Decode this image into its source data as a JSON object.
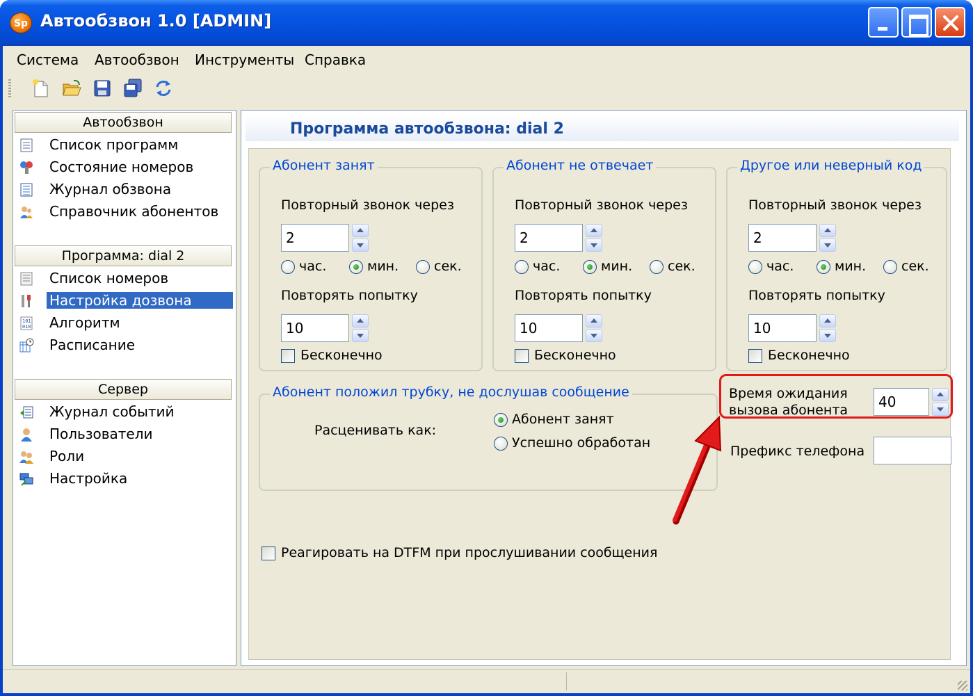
{
  "window": {
    "title": "Автообзвон 1.0 [ADMIN]",
    "icon_label": "Sp"
  },
  "menu": [
    "Система",
    "Автообзвон",
    "Инструменты",
    "Справка"
  ],
  "toolbar": [
    "new-icon",
    "open-icon",
    "save-icon",
    "save-all-icon",
    "refresh-icon"
  ],
  "sidebar": {
    "sections": [
      {
        "header": "Автообзвон",
        "items": [
          {
            "label": "Список программ",
            "icon": "list-icon"
          },
          {
            "label": "Состояние номеров",
            "icon": "status-icon"
          },
          {
            "label": "Журнал обзвона",
            "icon": "log-icon"
          },
          {
            "label": "Справочник абонентов",
            "icon": "contacts-icon"
          }
        ]
      },
      {
        "header": "Программа: dial 2",
        "items": [
          {
            "label": "Список номеров",
            "icon": "numbers-icon"
          },
          {
            "label": "Настройка дозвона",
            "icon": "tools-icon",
            "selected": true
          },
          {
            "label": "Алгоритм",
            "icon": "algorithm-icon"
          },
          {
            "label": "Расписание",
            "icon": "schedule-icon"
          }
        ]
      },
      {
        "header": "Сервер",
        "items": [
          {
            "label": "Журнал событий",
            "icon": "events-icon"
          },
          {
            "label": "Пользователи",
            "icon": "user-icon"
          },
          {
            "label": "Роли",
            "icon": "roles-icon"
          },
          {
            "label": "Настройка",
            "icon": "settings-icon"
          }
        ]
      }
    ]
  },
  "main": {
    "title": "Программа автообзвона: dial 2",
    "groups": [
      {
        "title": "Абонент занят",
        "retry_label": "Повторный звонок через",
        "retry_value": "2",
        "units": [
          "час.",
          "мин.",
          "сек."
        ],
        "unit_selected": "мин.",
        "repeat_label": "Повторять попытку",
        "repeat_value": "10",
        "infinite_label": "Бесконечно",
        "infinite_checked": false
      },
      {
        "title": "Абонент не отвечает",
        "retry_label": "Повторный звонок через",
        "retry_value": "2",
        "units": [
          "час.",
          "мин.",
          "сек."
        ],
        "unit_selected": "мин.",
        "repeat_label": "Повторять попытку",
        "repeat_value": "10",
        "infinite_label": "Бесконечно",
        "infinite_checked": false
      },
      {
        "title": "Другое или неверный код",
        "retry_label": "Повторный звонок через",
        "retry_value": "2",
        "units": [
          "час.",
          "мин.",
          "сек."
        ],
        "unit_selected": "мин.",
        "repeat_label": "Повторять попытку",
        "repeat_value": "10",
        "infinite_label": "Бесконечно",
        "infinite_checked": false
      }
    ],
    "hangup": {
      "title": "Абонент положил трубку, не дослушав сообщение",
      "label": "Расценивать как:",
      "options": [
        "Абонент занят",
        "Успешно обработан"
      ],
      "selected": "Абонент занят"
    },
    "wait_time": {
      "label_line1": "Время ожидания",
      "label_line2": "вызова абонента",
      "value": "40"
    },
    "phone_prefix": {
      "label": "Префикс телефона",
      "value": ""
    },
    "dtmf": {
      "label": "Реагировать на DTFM при прослушивании сообщения",
      "checked": false
    }
  },
  "status_bar": {
    "panes": [
      "",
      ""
    ]
  }
}
